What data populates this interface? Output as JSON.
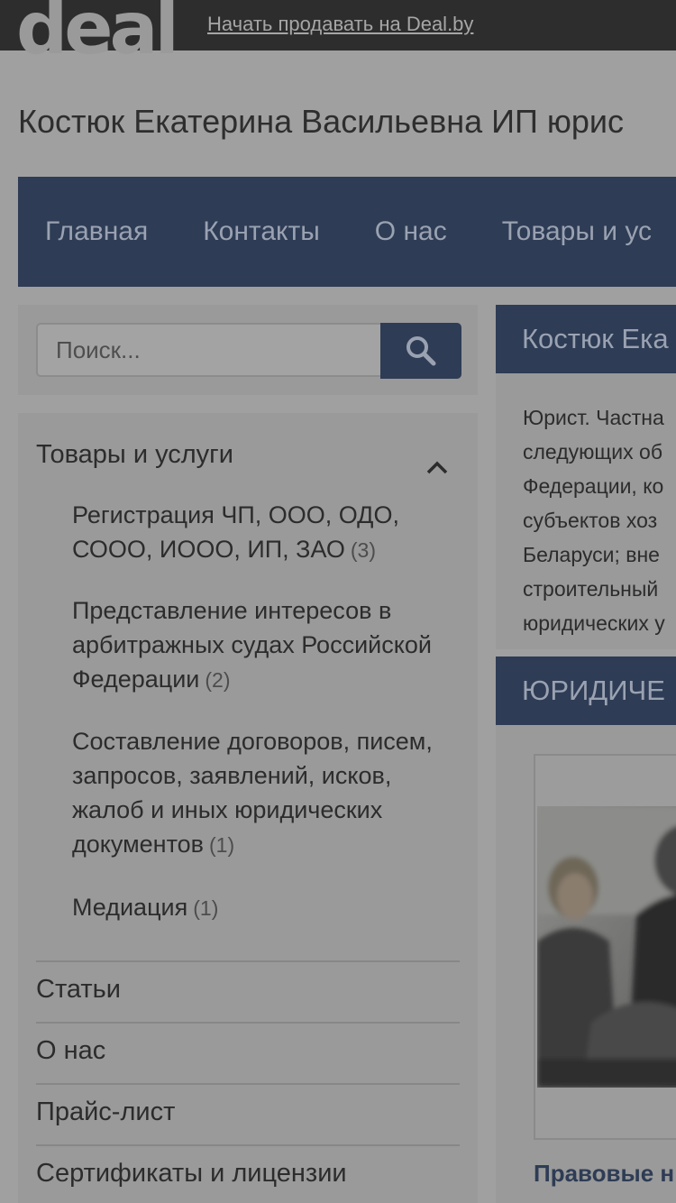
{
  "topbar": {
    "logo": "deal",
    "sell_link": "Начать продавать на Deal.by"
  },
  "company": {
    "title": "Костюк Екатерина Васильевна ИП юрис"
  },
  "nav": {
    "items": [
      "Главная",
      "Контакты",
      "О нас",
      "Товары и ус"
    ]
  },
  "search": {
    "placeholder": "Поиск..."
  },
  "catalog": {
    "heading": "Товары и услуги",
    "items": [
      {
        "label": "Регистрация ЧП, ООО, ОДО, СООО, ИООО, ИП, ЗАО",
        "count": "(3)"
      },
      {
        "label": "Представление интересов в арбитражных судах Российской Федерации",
        "count": "(2)"
      },
      {
        "label": "Составление договоров, писем, запросов, заявлений, исков, жалоб и иных юридических документов",
        "count": "(1)"
      },
      {
        "label": "Медиация",
        "count": "(1)"
      }
    ]
  },
  "menu": {
    "items": [
      "Статьи",
      "О нас",
      "Прайс-лист",
      "Сертификаты и лицензии"
    ]
  },
  "about": {
    "heading": "Костюк Ека",
    "lines": [
      "Юрист. Частна",
      "следующих об",
      "Федерации, ко",
      "субъектов хоз",
      "Беларуси; вне",
      "строительный",
      "юридических у"
    ]
  },
  "products": {
    "heading": "ЮРИДИЧЕ",
    "first_link": "Правовые н"
  }
}
